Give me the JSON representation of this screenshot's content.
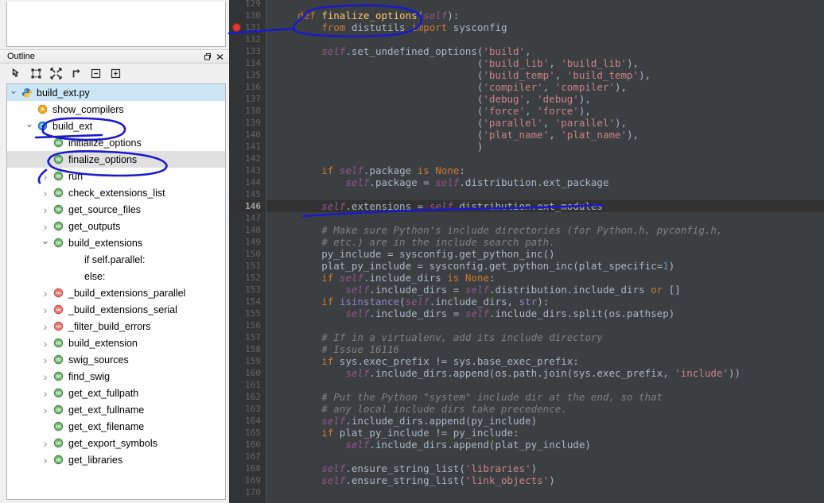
{
  "outline_panel": {
    "title": "Outline",
    "header_buttons": [
      {
        "name": "minimize-restore-button",
        "glyph": "restore"
      },
      {
        "name": "close-button",
        "glyph": "close"
      }
    ],
    "toolbar_buttons": [
      {
        "name": "focus-on-active-task-button",
        "glyph": "pointer"
      },
      {
        "name": "collapse-all-button",
        "glyph": "collapse-all"
      },
      {
        "name": "expand-all-button",
        "glyph": "expand-all"
      },
      {
        "name": "sort-button",
        "glyph": "sort-arrow"
      },
      {
        "name": "collapse-button",
        "glyph": "minus-box"
      },
      {
        "name": "expand-button",
        "glyph": "plus-box"
      }
    ],
    "tree": [
      {
        "label": "build_ext.py",
        "indent": 0,
        "twisty": "open",
        "icon": "python-file-icon",
        "state": "selected"
      },
      {
        "label": "show_compilers",
        "indent": 1,
        "twisty": "none",
        "icon": "function-orange-icon",
        "state": ""
      },
      {
        "label": "build_ext",
        "indent": 1,
        "twisty": "open",
        "icon": "class-blue-icon",
        "state": ""
      },
      {
        "label": "initialize_options",
        "indent": 2,
        "twisty": "none",
        "icon": "method-green-icon",
        "state": ""
      },
      {
        "label": "finalize_options",
        "indent": 2,
        "twisty": "none",
        "icon": "method-green-icon",
        "state": "hover"
      },
      {
        "label": "run",
        "indent": 2,
        "twisty": "closed",
        "icon": "method-green-icon",
        "state": ""
      },
      {
        "label": "check_extensions_list",
        "indent": 2,
        "twisty": "closed",
        "icon": "method-green-icon",
        "state": ""
      },
      {
        "label": "get_source_files",
        "indent": 2,
        "twisty": "closed",
        "icon": "method-green-icon",
        "state": ""
      },
      {
        "label": "get_outputs",
        "indent": 2,
        "twisty": "closed",
        "icon": "method-green-icon",
        "state": ""
      },
      {
        "label": "build_extensions",
        "indent": 2,
        "twisty": "open",
        "icon": "method-green-icon",
        "state": ""
      },
      {
        "label": "if self.parallel:",
        "indent": 3,
        "twisty": "none",
        "icon": "none",
        "state": ""
      },
      {
        "label": "else:",
        "indent": 3,
        "twisty": "none",
        "icon": "none",
        "state": ""
      },
      {
        "label": "_build_extensions_parallel",
        "indent": 2,
        "twisty": "closed",
        "icon": "method-private-red-icon",
        "state": ""
      },
      {
        "label": "_build_extensions_serial",
        "indent": 2,
        "twisty": "closed",
        "icon": "method-private-red-icon",
        "state": ""
      },
      {
        "label": "_filter_build_errors",
        "indent": 2,
        "twisty": "closed",
        "icon": "method-private-red-icon",
        "state": ""
      },
      {
        "label": "build_extension",
        "indent": 2,
        "twisty": "closed",
        "icon": "method-green-icon",
        "state": ""
      },
      {
        "label": "swig_sources",
        "indent": 2,
        "twisty": "closed",
        "icon": "method-green-icon",
        "state": ""
      },
      {
        "label": "find_swig",
        "indent": 2,
        "twisty": "closed",
        "icon": "method-green-icon",
        "state": ""
      },
      {
        "label": "get_ext_fullpath",
        "indent": 2,
        "twisty": "closed",
        "icon": "method-green-icon",
        "state": ""
      },
      {
        "label": "get_ext_fullname",
        "indent": 2,
        "twisty": "closed",
        "icon": "method-green-icon",
        "state": ""
      },
      {
        "label": "get_ext_filename",
        "indent": 2,
        "twisty": "none",
        "icon": "method-green-icon",
        "state": ""
      },
      {
        "label": "get_export_symbols",
        "indent": 2,
        "twisty": "closed",
        "icon": "method-green-icon",
        "state": ""
      },
      {
        "label": "get_libraries",
        "indent": 2,
        "twisty": "closed",
        "icon": "method-green-icon",
        "state": ""
      }
    ]
  },
  "editor": {
    "current_line": 146,
    "breakpoint_line": 131,
    "first_line": 129,
    "last_line": 170,
    "theme_colors": {
      "background": "#3c3f41",
      "gutter": "#313335",
      "current_line_highlight": "#323232",
      "default_text": "#a9b7c6",
      "keyword": "#cc7832",
      "function_name": "#ffc66d",
      "self_keyword": "#94558d",
      "string": "#a5c261",
      "comment": "#808080",
      "number": "#6897bb",
      "line_number": "#646464",
      "annotation_ink": "#1a1acd"
    },
    "lines": [
      {
        "n": 129,
        "html": ""
      },
      {
        "n": 130,
        "html": "    <span class=\"kw\">def</span> <span class=\"def\">finalize_options</span>(<span class=\"self\">self</span>):"
      },
      {
        "n": 131,
        "html": "        <span class=\"kw\">from</span> distutils <span class=\"kw\">import</span> sysconfig"
      },
      {
        "n": 132,
        "html": ""
      },
      {
        "n": 133,
        "html": "        <span class=\"self\">self</span>.set_undefined_options(<span class=\"strpk\">'build'</span>,"
      },
      {
        "n": 134,
        "html": "                                  (<span class=\"strpk\">'build_lib'</span>, <span class=\"strpk\">'build_lib'</span>),"
      },
      {
        "n": 135,
        "html": "                                  (<span class=\"strpk\">'build_temp'</span>, <span class=\"strpk\">'build_temp'</span>),"
      },
      {
        "n": 136,
        "html": "                                  (<span class=\"strpk\">'compiler'</span>, <span class=\"strpk\">'compiler'</span>),"
      },
      {
        "n": 137,
        "html": "                                  (<span class=\"strpk\">'debug'</span>, <span class=\"strpk\">'debug'</span>),"
      },
      {
        "n": 138,
        "html": "                                  (<span class=\"strpk\">'force'</span>, <span class=\"strpk\">'force'</span>),"
      },
      {
        "n": 139,
        "html": "                                  (<span class=\"strpk\">'parallel'</span>, <span class=\"strpk\">'parallel'</span>),"
      },
      {
        "n": 140,
        "html": "                                  (<span class=\"strpk\">'plat_name'</span>, <span class=\"strpk\">'plat_name'</span>),"
      },
      {
        "n": 141,
        "html": "                                  )"
      },
      {
        "n": 142,
        "html": ""
      },
      {
        "n": 143,
        "html": "        <span class=\"kw\">if</span> <span class=\"self\">self</span>.package <span class=\"kw\">is</span> <span class=\"kwn\">None</span>:"
      },
      {
        "n": 144,
        "html": "            <span class=\"self\">self</span>.package = <span class=\"self\">self</span>.distribution.ext_package"
      },
      {
        "n": 145,
        "html": ""
      },
      {
        "n": 146,
        "html": "        <span class=\"self\">self</span>.extensions = <span class=\"self\">self</span>.distribution.ext_modules"
      },
      {
        "n": 147,
        "html": ""
      },
      {
        "n": 148,
        "html": "        <span class=\"cmt\"># Make sure Python's include directories (for Python.h, pyconfig.h,</span>"
      },
      {
        "n": 149,
        "html": "        <span class=\"cmt\"># etc.) are in the include search path.</span>"
      },
      {
        "n": 150,
        "html": "        py_include = sysconfig.get_python_inc()"
      },
      {
        "n": 151,
        "html": "        plat_py_include = sysconfig.get_python_inc(plat_specific=<span class=\"num\">1</span>)"
      },
      {
        "n": 152,
        "html": "        <span class=\"kw\">if</span> <span class=\"self\">self</span>.include_dirs <span class=\"kw\">is</span> <span class=\"kwn\">None</span>:"
      },
      {
        "n": 153,
        "html": "            <span class=\"self\">self</span>.include_dirs = <span class=\"self\">self</span>.distribution.include_dirs <span class=\"kw\">or</span> []"
      },
      {
        "n": 154,
        "html": "        <span class=\"kw\">if</span> <span class=\"bi\">isinstance</span>(<span class=\"self\">self</span>.include_dirs, <span class=\"bi\">str</span>):"
      },
      {
        "n": 155,
        "html": "            <span class=\"self\">self</span>.include_dirs = <span class=\"self\">self</span>.include_dirs.split(os.pathsep)"
      },
      {
        "n": 156,
        "html": ""
      },
      {
        "n": 157,
        "html": "        <span class=\"cmt\"># If in a virtualenv, add its include directory</span>"
      },
      {
        "n": 158,
        "html": "        <span class=\"cmt\"># Issue 16116</span>"
      },
      {
        "n": 159,
        "html": "        <span class=\"kw\">if</span> sys.exec_prefix != sys.base_exec_prefix:"
      },
      {
        "n": 160,
        "html": "            <span class=\"self\">self</span>.include_dirs.append(os.path.join(sys.exec_prefix, <span class=\"strpk\">'include'</span>))"
      },
      {
        "n": 161,
        "html": ""
      },
      {
        "n": 162,
        "html": "        <span class=\"cmt\"># Put the Python \"system\" include dir at the end, so that</span>"
      },
      {
        "n": 163,
        "html": "        <span class=\"cmt\"># any local include dirs take precedence.</span>"
      },
      {
        "n": 164,
        "html": "        <span class=\"self\">self</span>.include_dirs.append(py_include)"
      },
      {
        "n": 165,
        "html": "        <span class=\"kw\">if</span> plat_py_include != py_include:"
      },
      {
        "n": 166,
        "html": "            <span class=\"self\">self</span>.include_dirs.append(plat_py_include)"
      },
      {
        "n": 167,
        "html": ""
      },
      {
        "n": 168,
        "html": "        <span class=\"self\">self</span>.ensure_string_list(<span class=\"strpk\">'libraries'</span>)"
      },
      {
        "n": 169,
        "html": "        <span class=\"self\">self</span>.ensure_string_list(<span class=\"strpk\">'link_objects'</span>)"
      },
      {
        "n": 170,
        "html": ""
      }
    ]
  },
  "annotations": {
    "ink_color": "#1a1acd",
    "marks": [
      {
        "name": "circle-around-finalize-options-def",
        "target": "code line 130 def finalize_options"
      },
      {
        "name": "underline-under-build-ext",
        "target": "outline item build_ext"
      },
      {
        "name": "circle-around-finalize-options-outline",
        "target": "outline item finalize_options"
      },
      {
        "name": "underline-under-extensions-assignment",
        "target": "code line 146"
      }
    ]
  }
}
